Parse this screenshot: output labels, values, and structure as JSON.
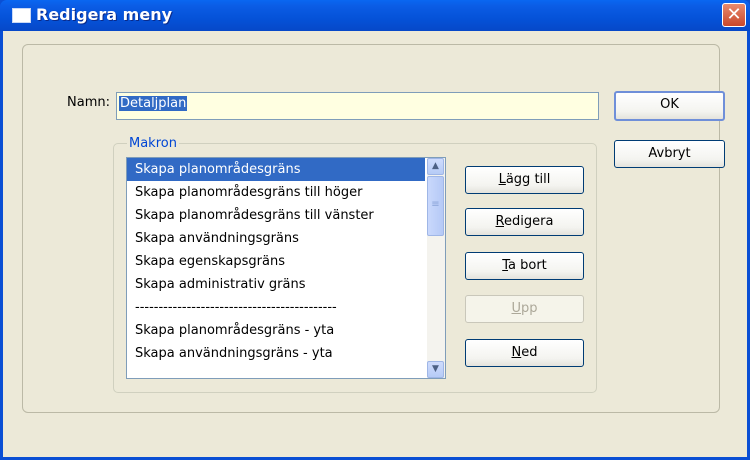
{
  "window": {
    "title": "Redigera meny",
    "close_glyph": "✕"
  },
  "form": {
    "name_label": "Namn:",
    "name_value": "Detaljplan",
    "group_label": "Makron"
  },
  "macros": {
    "items": [
      "Skapa planområdesgräns",
      "Skapa planområdesgräns till höger",
      "Skapa planområdesgräns till vänster",
      "Skapa användningsgräns",
      "Skapa egenskapsgräns",
      "Skapa administrativ gräns",
      "-------------------------------------------",
      "Skapa planområdesgräns - yta",
      "Skapa användningsgräns - yta"
    ],
    "selected_index": 0
  },
  "buttons": {
    "ok": "OK",
    "cancel": "Avbryt",
    "add_first": "L",
    "add_rest": "ägg till",
    "edit_first": "R",
    "edit_rest": "edigera",
    "remove_first": "T",
    "remove_rest": "a bort",
    "up_first": "U",
    "up_rest": "pp",
    "down_first": "N",
    "down_rest": "ed"
  },
  "icons": {
    "window_icon": "window-icon",
    "close": "close-icon",
    "scroll_up": "scroll-up-icon",
    "scroll_down": "scroll-down-icon"
  },
  "colors": {
    "titlebar": "#0552d8",
    "selection": "#316ac5",
    "input_bg": "#ffffe1",
    "group_label": "#0046d5"
  }
}
